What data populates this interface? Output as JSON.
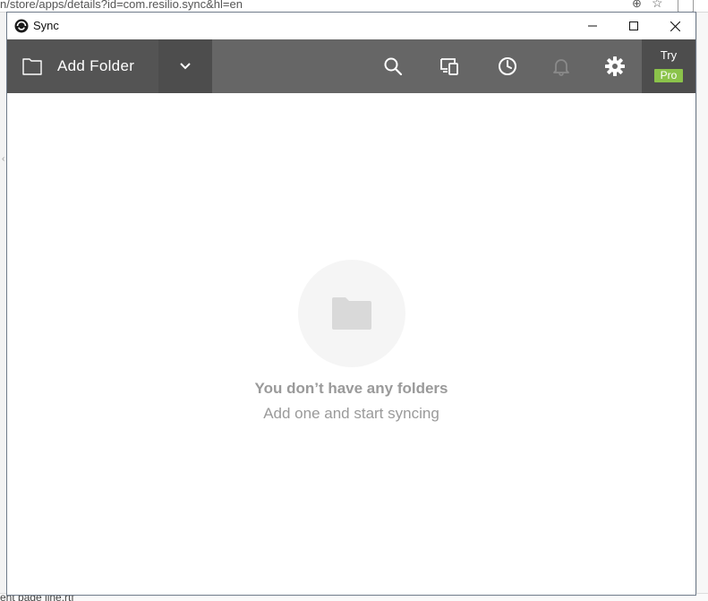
{
  "browser": {
    "url_fragment": "n/store/apps/details?id=com.resilio.sync&hl=en",
    "bottom_text": "ent page line.rtf"
  },
  "window": {
    "title": "Sync",
    "controls": {
      "minimize": "minimize-icon",
      "maximize": "maximize-icon",
      "close": "close-icon"
    }
  },
  "toolbar": {
    "add_folder_label": "Add Folder",
    "icons": [
      "search-icon",
      "devices-icon",
      "history-icon",
      "bell-icon",
      "gear-icon"
    ],
    "try_label": "Try",
    "pro_label": "Pro",
    "pro_color": "#8bc34a"
  },
  "empty_state": {
    "title": "You don’t have any folders",
    "subtitle": "Add one and start syncing"
  },
  "colors": {
    "toolbar": "#666666",
    "add_folder_bg": "#545454",
    "dropdown_bg": "#4d4d4d",
    "empty_text": "#9a9a9a"
  }
}
